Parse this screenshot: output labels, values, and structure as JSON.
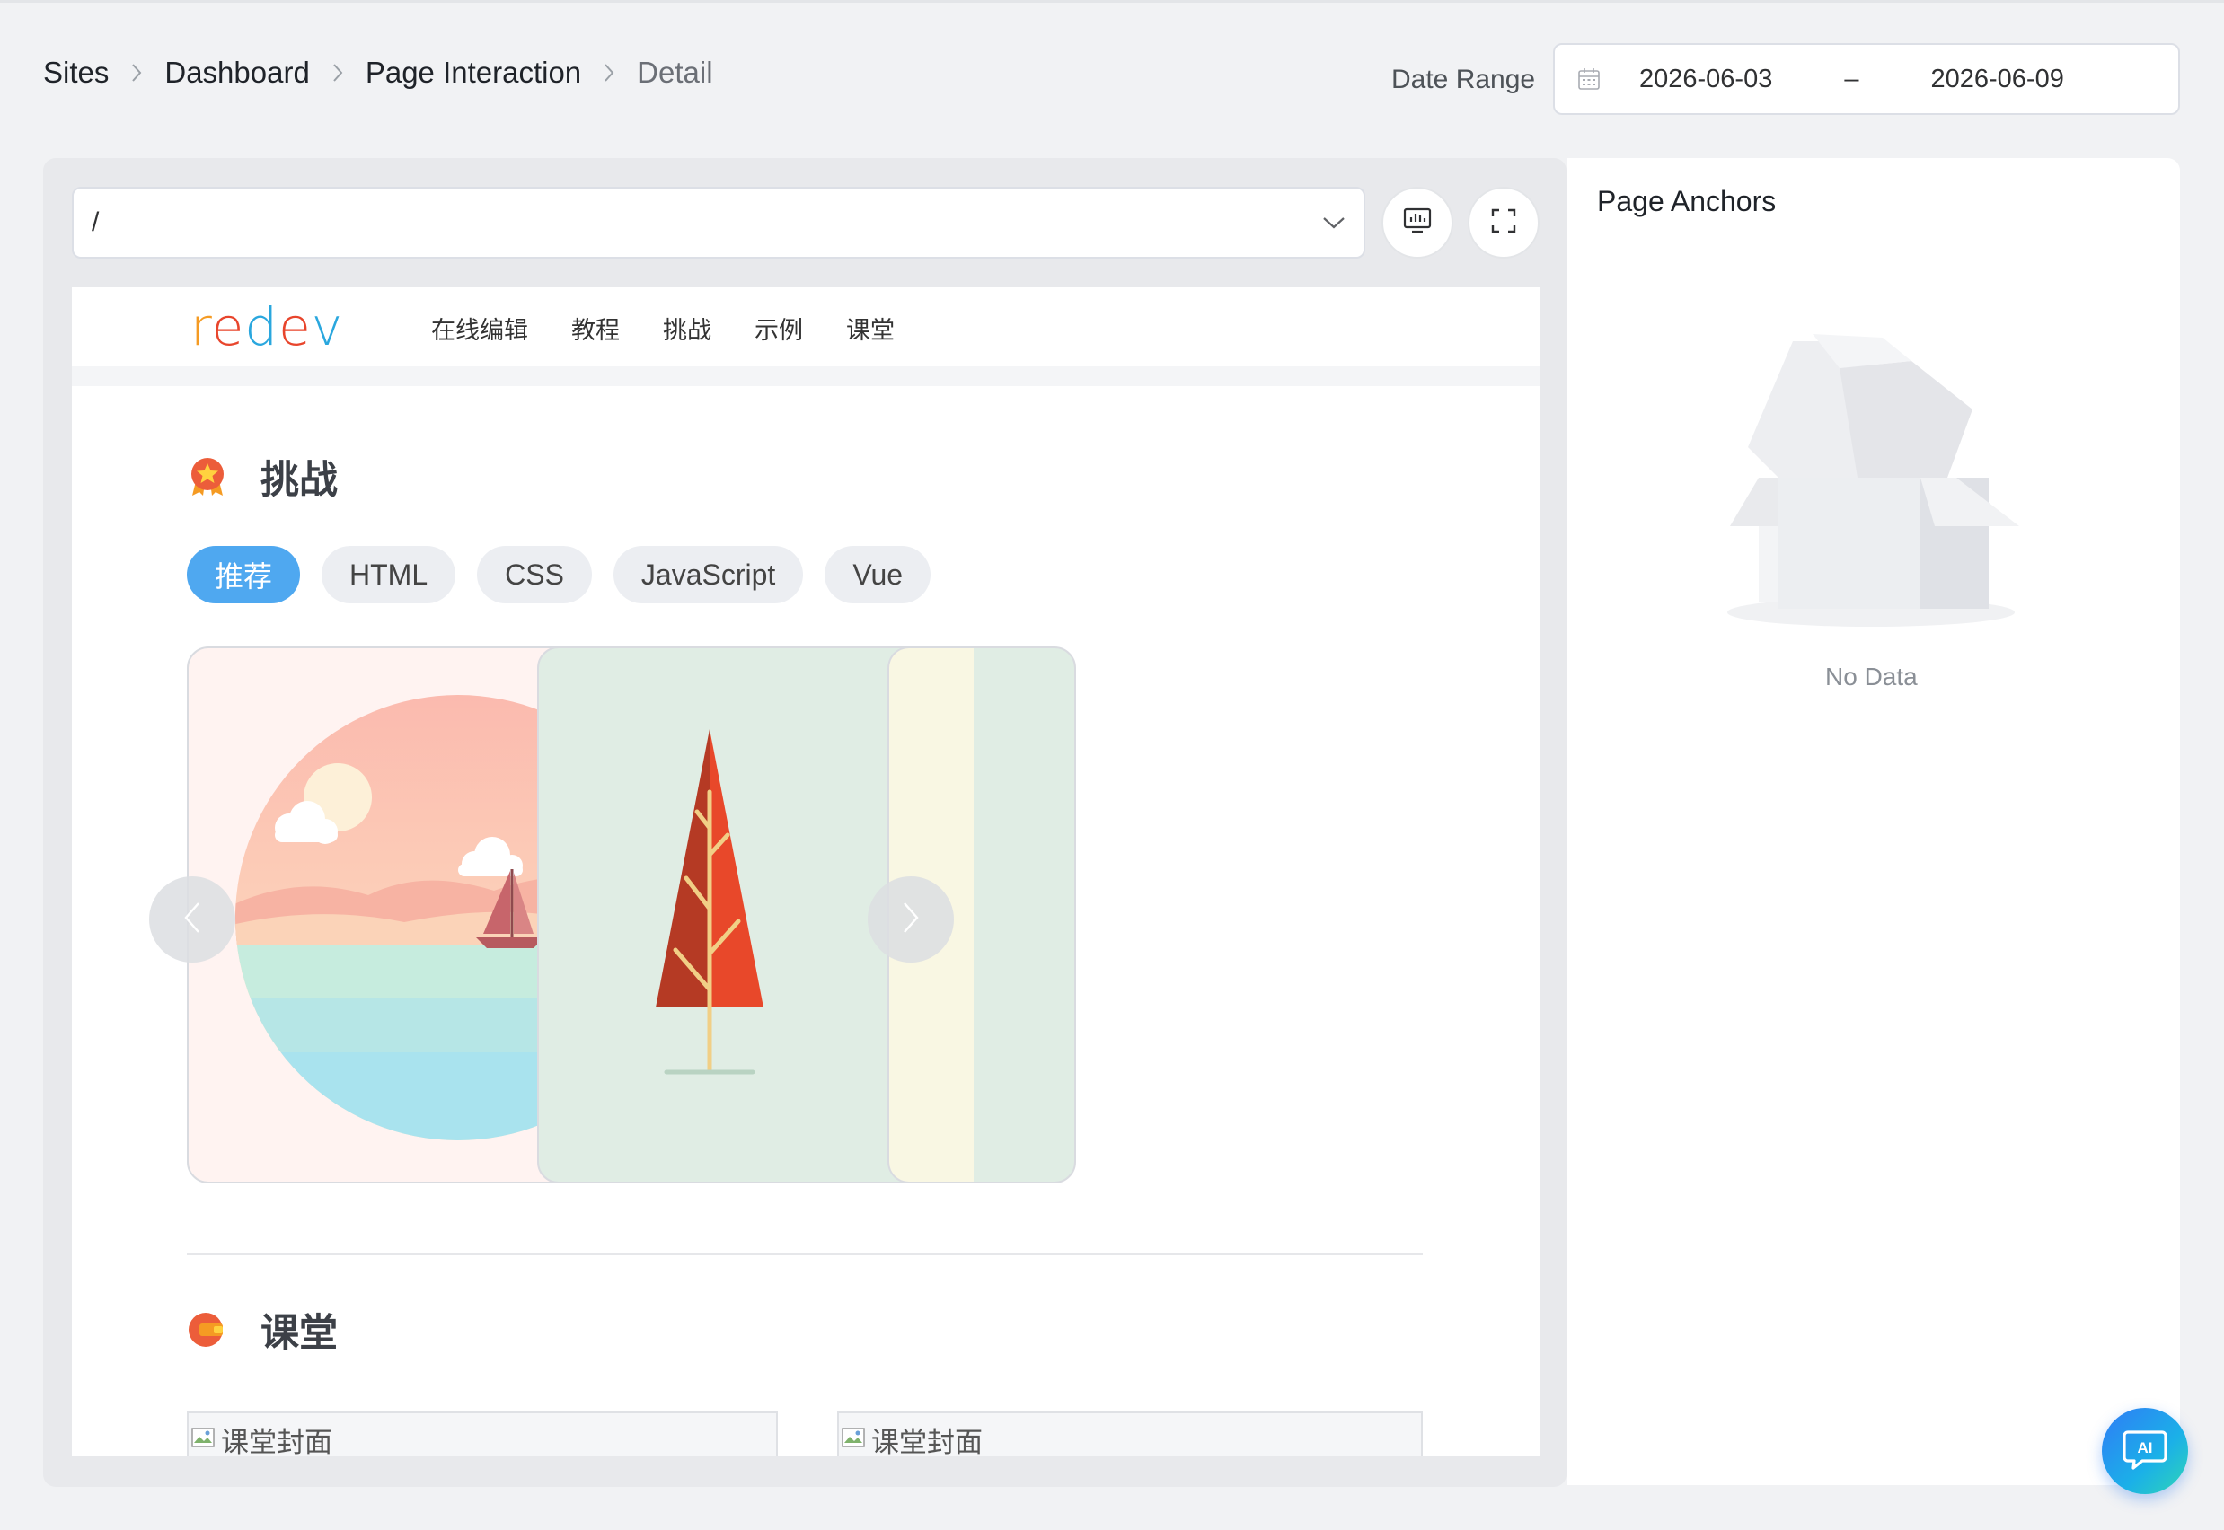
{
  "breadcrumb": {
    "items": [
      "Sites",
      "Dashboard",
      "Page Interaction"
    ],
    "current": "Detail"
  },
  "date_range": {
    "label": "Date Range",
    "start": "2026-06-03",
    "separator": "–",
    "end": "2026-06-09"
  },
  "url_select": {
    "value": "/"
  },
  "preview": {
    "logo": {
      "text": "redev",
      "colors": [
        "#f59b23",
        "#e8452c",
        "#2aa7de"
      ]
    },
    "menu": [
      "在线编辑",
      "教程",
      "挑战",
      "示例",
      "课堂"
    ],
    "challenge": {
      "title": "挑战",
      "tags": [
        "推荐",
        "HTML",
        "CSS",
        "JavaScript",
        "Vue"
      ],
      "active_tag": "推荐"
    },
    "classroom": {
      "title": "课堂",
      "cover_alt": [
        "课堂封面",
        "课堂封面"
      ]
    }
  },
  "anchors": {
    "title": "Page Anchors",
    "empty_text": "No Data"
  },
  "ai_button": {
    "label": "AI"
  },
  "colors": {
    "accent": "#4fa8f0",
    "ai_gradient": [
      "#2f7cf6",
      "#2fd6b5"
    ]
  }
}
